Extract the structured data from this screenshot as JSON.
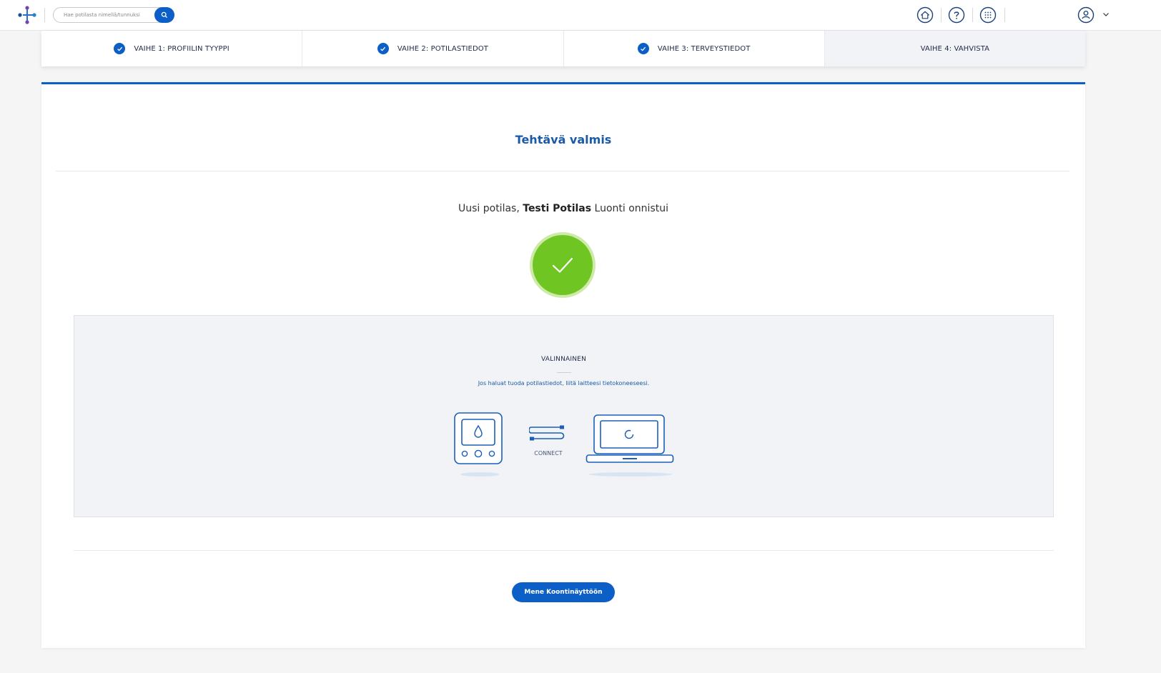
{
  "topbar": {
    "search": {
      "placeholder": "Hae potilasta nimellä/tunnuksi"
    },
    "icons": [
      "logo-icon",
      "search-icon",
      "home-icon",
      "help-icon",
      "apps-grid-icon",
      "user-icon",
      "chevron-down-icon"
    ]
  },
  "steps": [
    {
      "label": "VAIHE 1: PROFIILIN TYYPPI",
      "completed": true
    },
    {
      "label": "VAIHE 2: POTILASTIEDOT",
      "completed": true
    },
    {
      "label": "VAIHE 3: TERVEYSTIEDOT",
      "completed": true
    },
    {
      "label": "VAIHE 4: VAHVISTA",
      "completed": false
    }
  ],
  "card": {
    "title": "Tehtävä valmis",
    "message_prefix": "Uusi potilas,",
    "patient_name": "Testi Potilas",
    "message_suffix": "Luonti onnistui",
    "optional": {
      "title": "VALINNAINEN",
      "text": "Jos haluat tuoda potilastiedot, liitä laitteesi tietokoneeseesi.",
      "connect_label": "CONNECT"
    },
    "primary_button": "Mene Koontinäyttöön"
  },
  "colors": {
    "accent": "#0b5fc6",
    "title_blue": "#1a5aa8",
    "success_green": "#6fc622"
  }
}
